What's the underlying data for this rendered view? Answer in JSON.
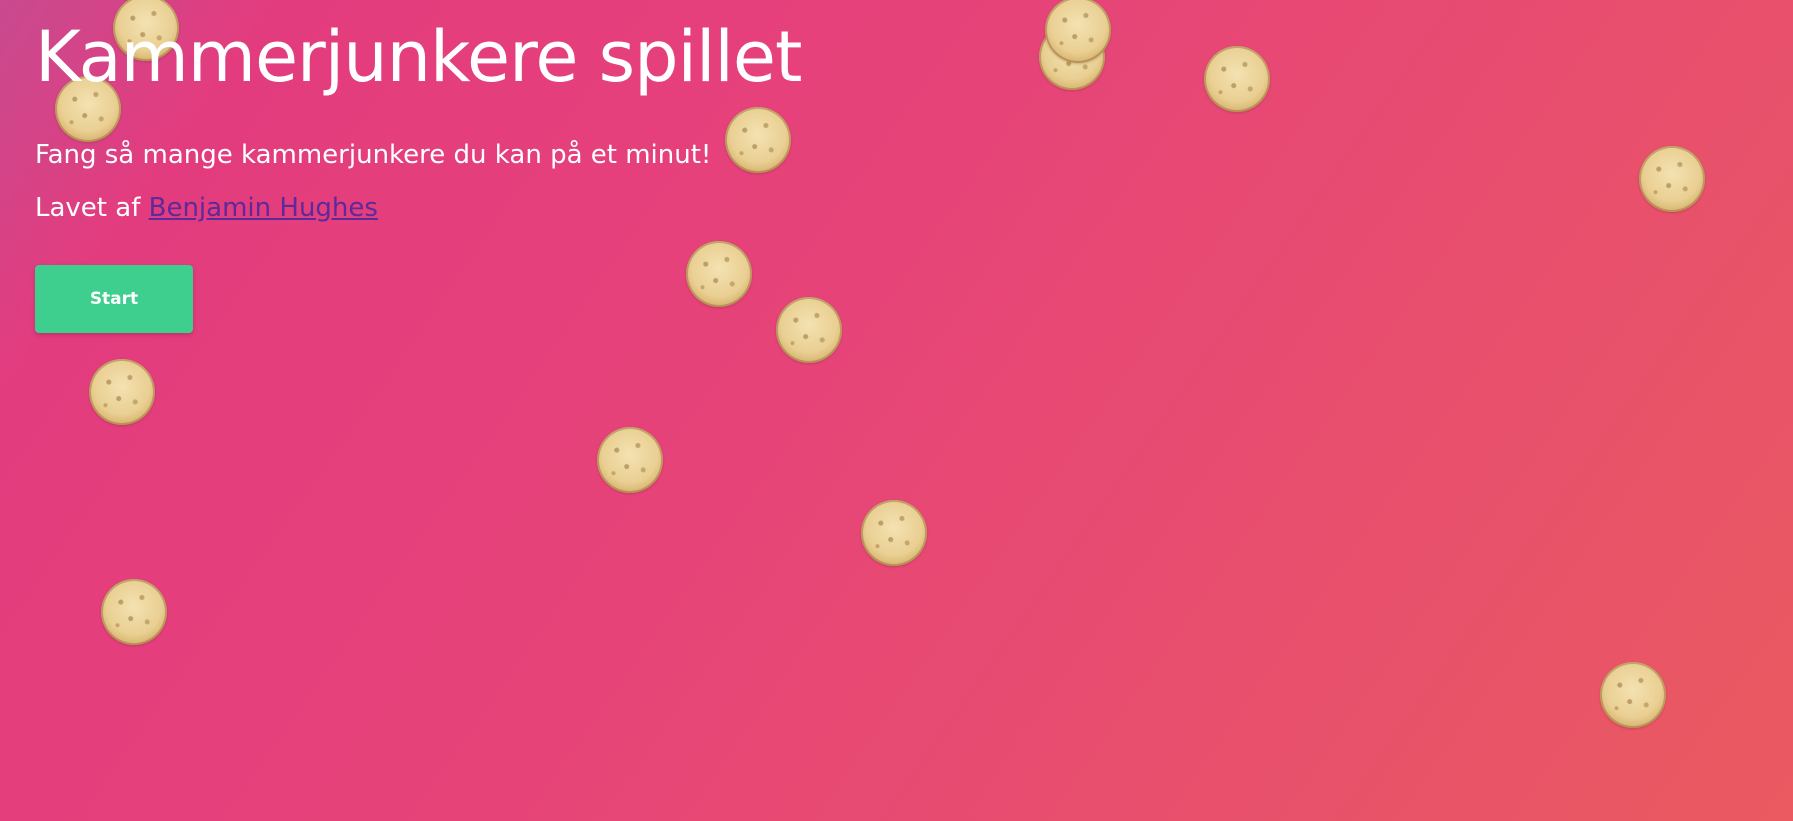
{
  "page": {
    "title": "Kammerjunkere spillet",
    "subtitle": "Fang så mange kammerjunkere du kan på et minut!",
    "credit_prefix": "Lavet af",
    "author_link_text": "Benjamin Hughes",
    "start_button_label": "Start"
  },
  "theme": {
    "gradient_start": "#c94a8f",
    "gradient_mid": "#e33c7e",
    "gradient_end": "#ea5a60",
    "button_color": "#3ecf8e",
    "link_color": "#5d2a9b"
  },
  "game": {
    "cookie_sprite": "kammerjunker-cookie-icon"
  }
}
